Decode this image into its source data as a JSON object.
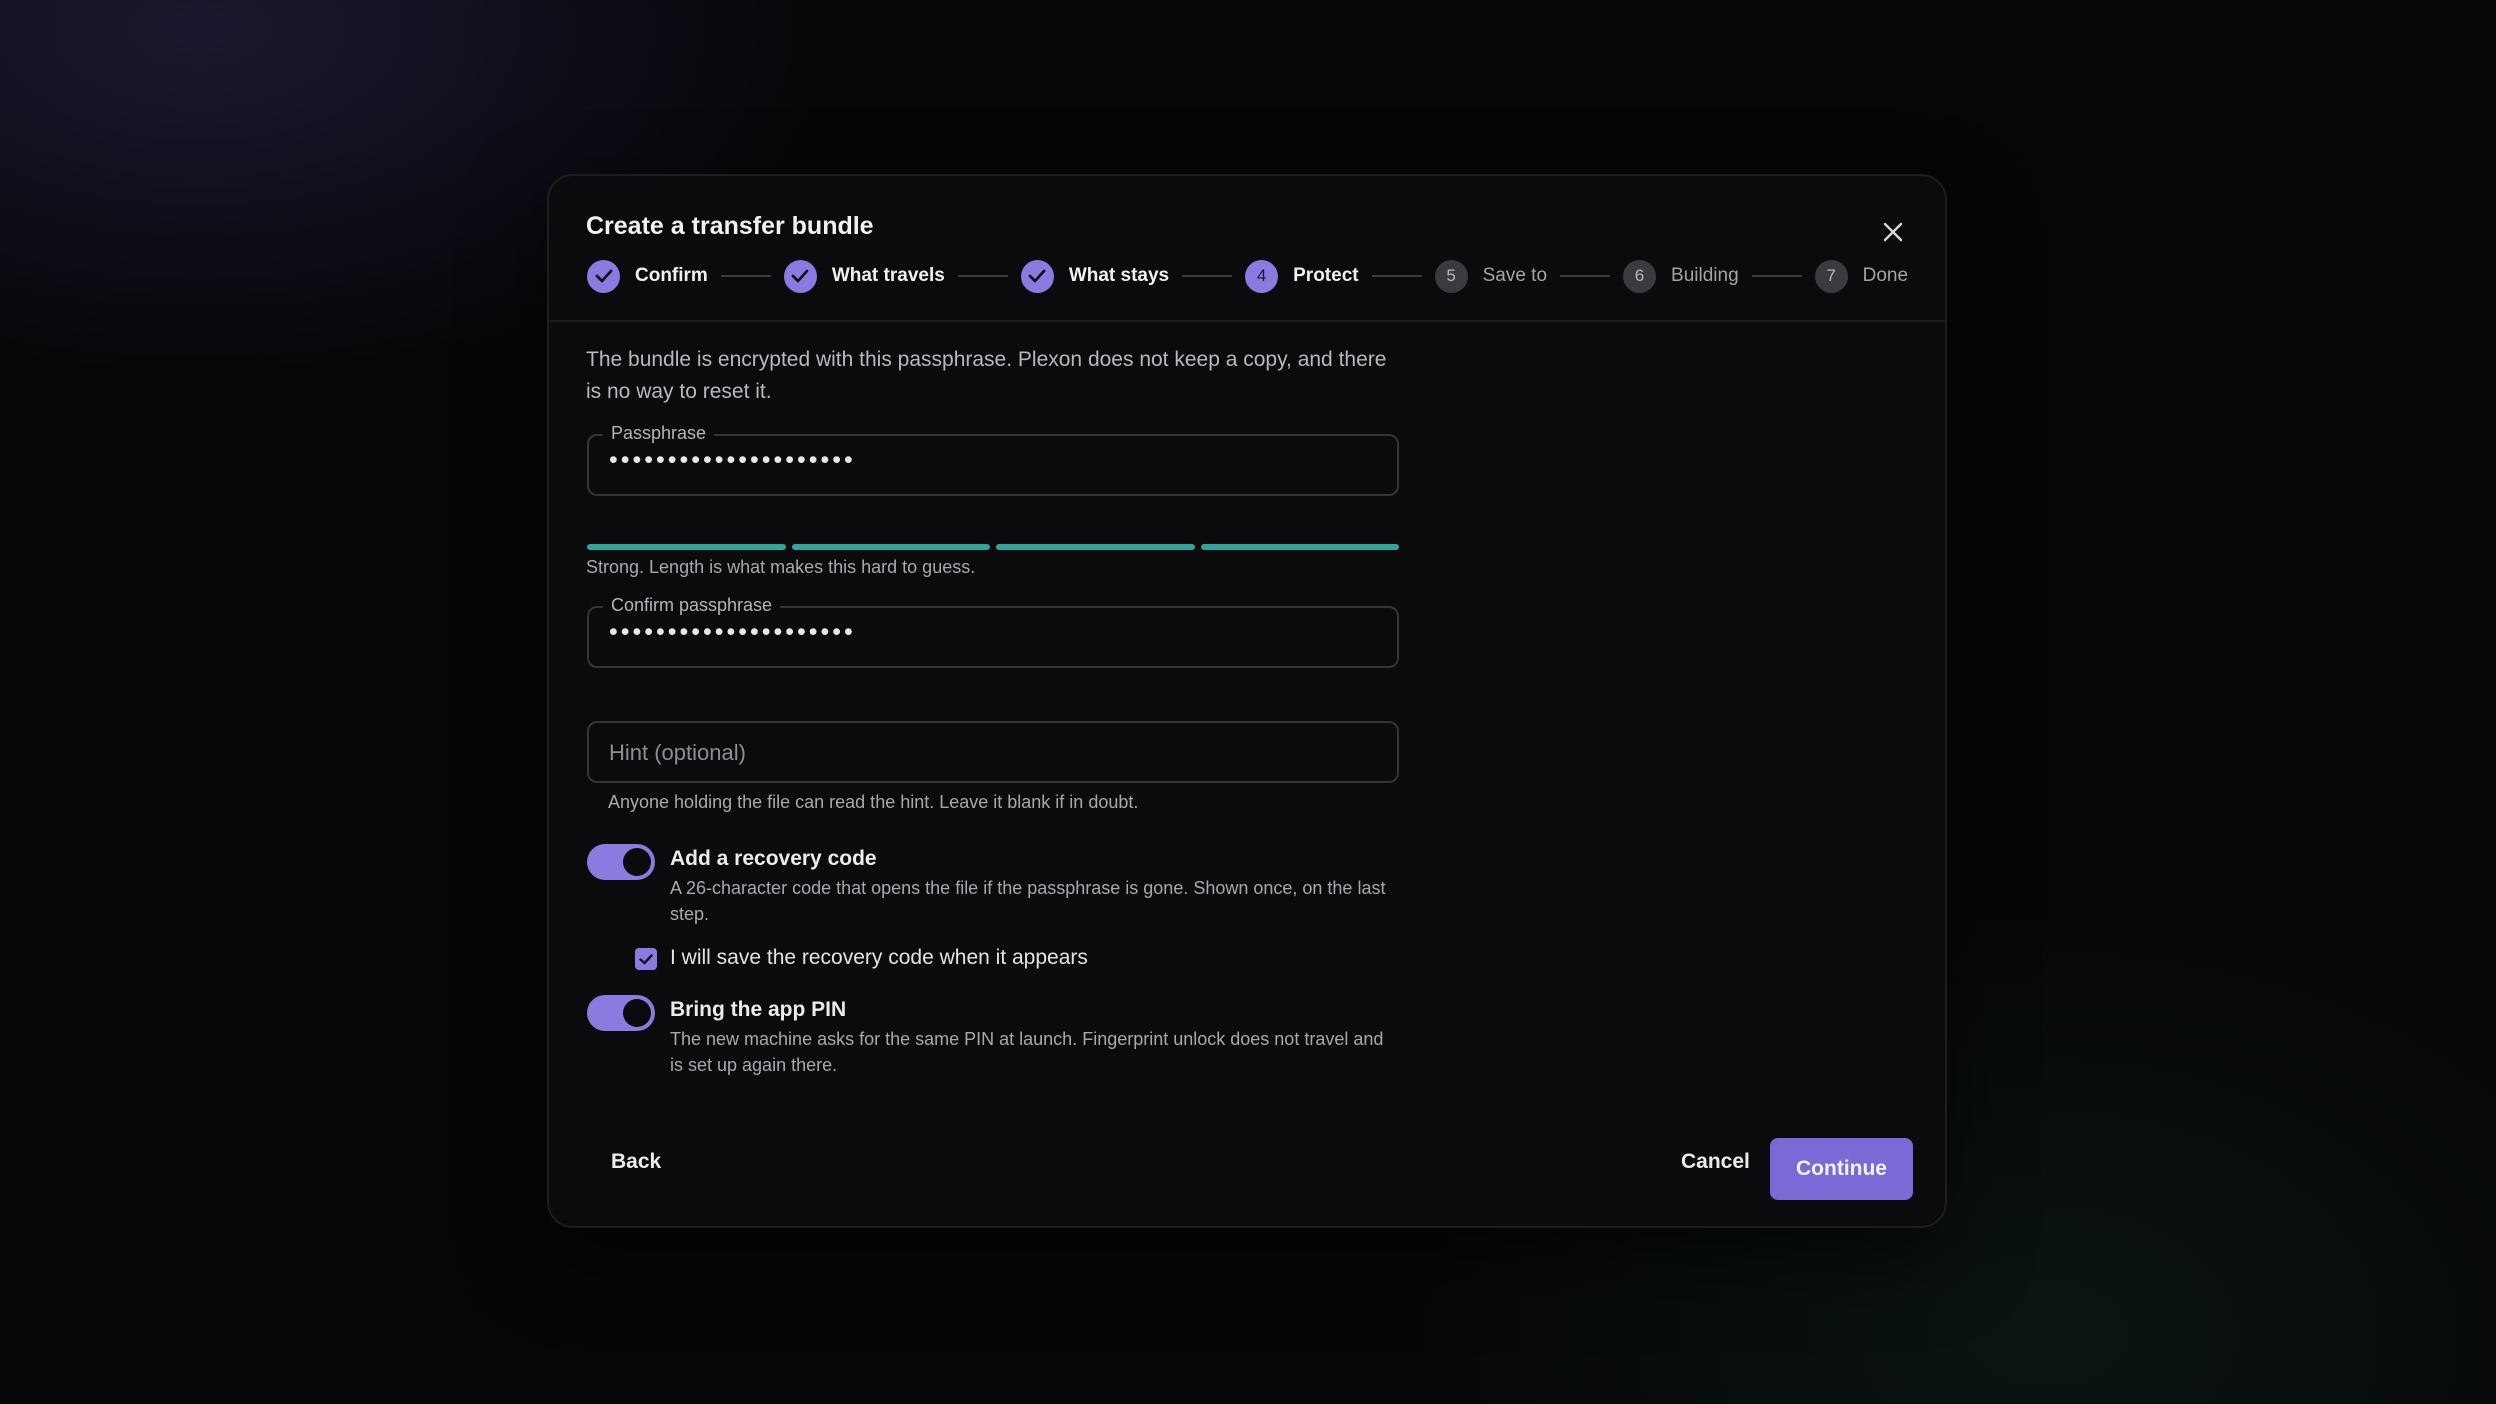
{
  "dialog": {
    "title": "Create a transfer bundle",
    "close_icon": "close-icon"
  },
  "stepper": {
    "steps": [
      {
        "label": "Confirm",
        "state": "done",
        "number": "1"
      },
      {
        "label": "What travels",
        "state": "done",
        "number": "2"
      },
      {
        "label": "What stays",
        "state": "done",
        "number": "3"
      },
      {
        "label": "Protect",
        "state": "active",
        "number": "4"
      },
      {
        "label": "Save to",
        "state": "pending",
        "number": "5"
      },
      {
        "label": "Building",
        "state": "pending",
        "number": "6"
      },
      {
        "label": "Done",
        "state": "pending",
        "number": "7"
      }
    ]
  },
  "intro": "The bundle is encrypted with this passphrase. Plexon does not keep a copy, and there is no way to reset it.",
  "passphrase": {
    "label": "Passphrase",
    "value": "•••••••••••••••••••••"
  },
  "strength": {
    "segments_filled": 4,
    "segments_total": 4,
    "text": "Strong. Length is what makes this hard to guess.",
    "color": "#2fa59b"
  },
  "confirm_passphrase": {
    "label": "Confirm passphrase",
    "value": "•••••••••••••••••••••"
  },
  "hint": {
    "placeholder": "Hint (optional)",
    "help": "Anyone holding the file can read the hint. Leave it blank if in doubt."
  },
  "recovery": {
    "title": "Add a recovery code",
    "description": "A 26-character code that opens the file if the passphrase is gone. Shown once, on the last step.",
    "enabled": true,
    "checkbox_label": "I will save the recovery code when it appears",
    "checkbox_checked": true
  },
  "app_pin": {
    "title": "Bring the app PIN",
    "description": "The new machine asks for the same PIN at launch. Fingerprint unlock does not travel and is set up again there.",
    "enabled": true
  },
  "footer": {
    "back_label": "Back",
    "cancel_label": "Cancel",
    "continue_label": "Continue"
  },
  "colors": {
    "accent": "#8b7be0",
    "primary_button": "#7a6ad6",
    "strength": "#2fa59b"
  }
}
